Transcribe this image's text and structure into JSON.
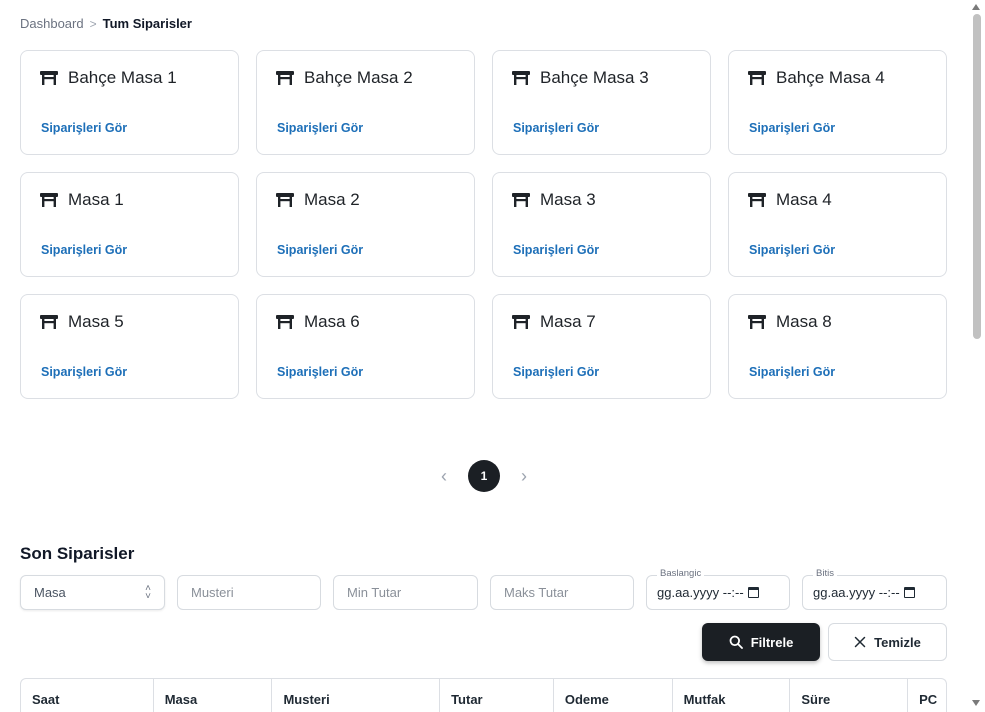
{
  "breadcrumb": {
    "home": "Dashboard",
    "separator": ">",
    "current": "Tum Siparisler"
  },
  "tables": [
    {
      "name": "Bahçe Masa 1",
      "link": "Siparişleri Gör"
    },
    {
      "name": "Bahçe Masa 2",
      "link": "Siparişleri Gör"
    },
    {
      "name": "Bahçe Masa 3",
      "link": "Siparişleri Gör"
    },
    {
      "name": "Bahçe Masa 4",
      "link": "Siparişleri Gör"
    },
    {
      "name": "Masa 1",
      "link": "Siparişleri Gör"
    },
    {
      "name": "Masa 2",
      "link": "Siparişleri Gör"
    },
    {
      "name": "Masa 3",
      "link": "Siparişleri Gör"
    },
    {
      "name": "Masa 4",
      "link": "Siparişleri Gör"
    },
    {
      "name": "Masa 5",
      "link": "Siparişleri Gör"
    },
    {
      "name": "Masa 6",
      "link": "Siparişleri Gör"
    },
    {
      "name": "Masa 7",
      "link": "Siparişleri Gör"
    },
    {
      "name": "Masa 8",
      "link": "Siparişleri Gör"
    }
  ],
  "pagination": {
    "prev": "‹",
    "current_page": "1",
    "next": "›"
  },
  "orders": {
    "title": "Son Siparisler",
    "filters": {
      "masa_select": "Masa",
      "musteri_placeholder": "Musteri",
      "min_tutar_placeholder": "Min Tutar",
      "maks_tutar_placeholder": "Maks Tutar",
      "start_label": "Baslangic",
      "start_value": "gg.aa.yyyy --:--",
      "end_label": "Bitis",
      "end_value": "gg.aa.yyyy --:--"
    },
    "buttons": {
      "filter": "Filtrele",
      "clear": "Temizle"
    },
    "columns": [
      "Saat",
      "Masa",
      "Musteri",
      "Tutar",
      "Odeme",
      "Mutfak",
      "Süre",
      "PC"
    ]
  },
  "icons": {
    "table": "table-furniture-icon",
    "search": "search-icon",
    "close": "close-icon",
    "calendar": "calendar-icon"
  },
  "colors": {
    "link": "#1d6fb8",
    "primary_button": "#1b1f24",
    "card_border": "#dcdfe4"
  }
}
